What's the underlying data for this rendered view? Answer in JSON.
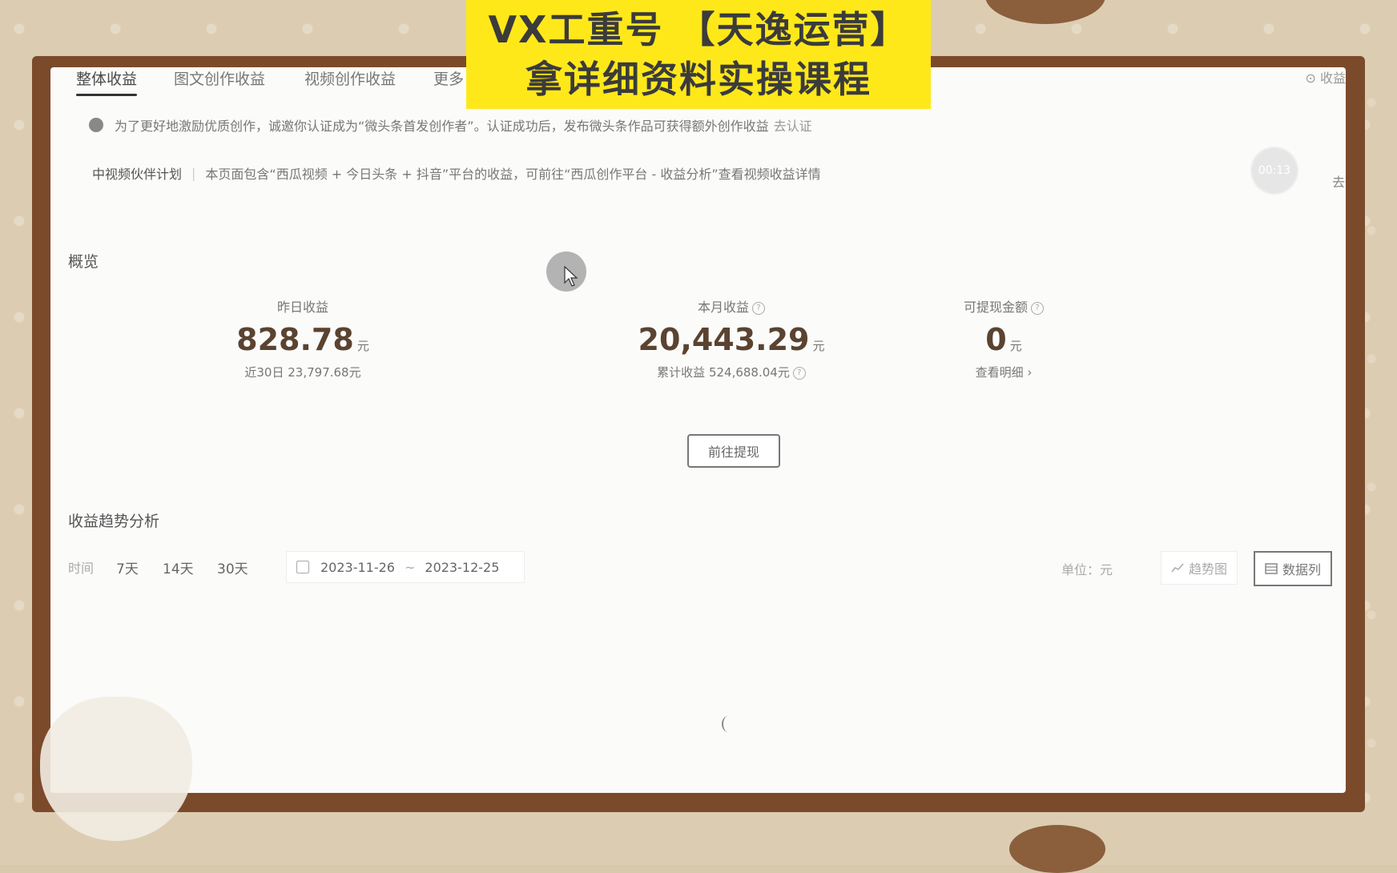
{
  "tabs": {
    "overall": "整体收益",
    "image_text": "图文创作收益",
    "video": "视频创作收益",
    "more": "更多"
  },
  "corner_link": "收益",
  "notice": {
    "text": "为了更好地激励优质创作，诚邀你认证成为“微头条首发创作者”。认证成功后，发布微头条作品可获得额外创作收益",
    "link": "去认证"
  },
  "plan": {
    "name": "中视频伙伴计划",
    "text": "本页面包含“西瓜视频 + 今日头条 + 抖音”平台的收益，可前往“西瓜创作平台 - 收益分析”查看视频收益详情"
  },
  "timer": "00:13",
  "go_link": "去查",
  "overview": {
    "title": "概览",
    "yesterday": {
      "label": "昨日收益",
      "value": "828.78",
      "unit": "元",
      "sub": "近30日 23,797.68元"
    },
    "month": {
      "label": "本月收益",
      "value": "20,443.29",
      "unit": "元",
      "sub": "累计收益 524,688.04元"
    },
    "withdrawable": {
      "label": "可提现金额",
      "value": "0",
      "unit": "元",
      "sub": "查看明细 ›"
    },
    "withdraw_button": "前往提现"
  },
  "trend": {
    "title": "收益趋势分析",
    "time_label": "时间",
    "ranges": [
      "7天",
      "14天",
      "30天"
    ],
    "date_start": "2023-11-26",
    "date_tilde": "~",
    "date_end": "2023-12-25",
    "unit_label": "单位：元",
    "view_chart": "趋势图",
    "view_table": "数据列"
  },
  "banner": {
    "line1": "VX工重号 【天逸运营】",
    "line2": "拿详细资料实操课程"
  }
}
